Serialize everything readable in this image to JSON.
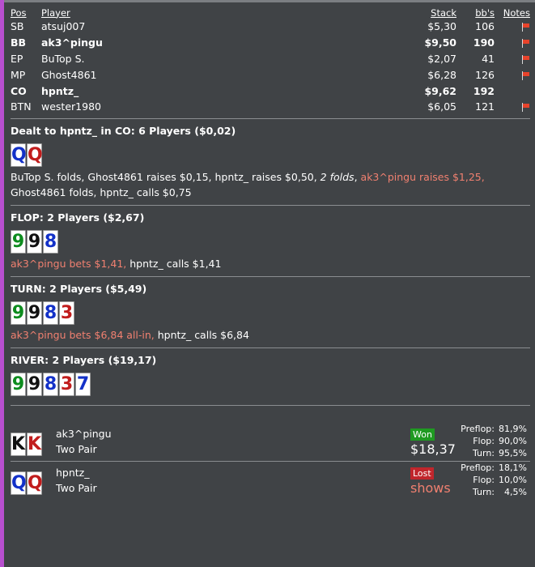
{
  "players_table": {
    "headers": {
      "pos": "Pos",
      "player": "Player",
      "stack": "Stack",
      "bbs": "bb's",
      "notes": "Notes"
    },
    "rows": [
      {
        "pos": "SB",
        "player": "atsuj007",
        "stack": "$5,30",
        "bbs": "106",
        "bold": false,
        "flag": true
      },
      {
        "pos": "BB",
        "player": "ak3^pingu",
        "stack": "$9,50",
        "bbs": "190",
        "bold": true,
        "flag": true
      },
      {
        "pos": "EP",
        "player": "BuTop S.",
        "stack": "$2,07",
        "bbs": "41",
        "bold": false,
        "flag": true
      },
      {
        "pos": "MP",
        "player": "Ghost4861",
        "stack": "$6,28",
        "bbs": "126",
        "bold": false,
        "flag": true
      },
      {
        "pos": "CO",
        "player": "hpntz_",
        "stack": "$9,62",
        "bbs": "192",
        "bold": true,
        "flag": false
      },
      {
        "pos": "BTN",
        "player": "wester1980",
        "stack": "$6,05",
        "bbs": "121",
        "bold": false,
        "flag": true
      }
    ]
  },
  "preflop": {
    "title": "Dealt to hpntz_ in CO: 6 Players ($0,02)",
    "cards": [
      {
        "rank": "Q",
        "suit": "d"
      },
      {
        "rank": "Q",
        "suit": "h"
      }
    ],
    "actions": [
      {
        "text": "BuTop S. folds, Ghost4861 raises $0,15, hpntz_ raises $0,50, ",
        "style": ""
      },
      {
        "text": "2 folds",
        "style": "it"
      },
      {
        "text": ", ",
        "style": ""
      },
      {
        "text": "ak3^pingu raises $1,25,",
        "style": "hl"
      },
      {
        "text": " Ghost4861 folds, hpntz_ calls $0,75",
        "style": ""
      }
    ]
  },
  "flop": {
    "title": "FLOP: 2 Players ($2,67)",
    "cards": [
      {
        "rank": "9",
        "suit": "c"
      },
      {
        "rank": "9",
        "suit": "s"
      },
      {
        "rank": "8",
        "suit": "d"
      }
    ],
    "actions": [
      {
        "text": "ak3^pingu bets $1,41,",
        "style": "hl"
      },
      {
        "text": " hpntz_ calls $1,41",
        "style": ""
      }
    ]
  },
  "turn": {
    "title": "TURN: 2 Players ($5,49)",
    "cards": [
      {
        "rank": "9",
        "suit": "c"
      },
      {
        "rank": "9",
        "suit": "s"
      },
      {
        "rank": "8",
        "suit": "d"
      },
      {
        "rank": "3",
        "suit": "h"
      }
    ],
    "actions": [
      {
        "text": "ak3^pingu bets $6,84 all-in,",
        "style": "hl"
      },
      {
        "text": " hpntz_ calls $6,84",
        "style": ""
      }
    ]
  },
  "river": {
    "title": "RIVER: 2 Players ($19,17)",
    "cards": [
      {
        "rank": "9",
        "suit": "c"
      },
      {
        "rank": "9",
        "suit": "s"
      },
      {
        "rank": "8",
        "suit": "d"
      },
      {
        "rank": "3",
        "suit": "h"
      },
      {
        "rank": "7",
        "suit": "d"
      }
    ]
  },
  "results": [
    {
      "player": "ak3^pingu",
      "hand_desc": "Two Pair",
      "cards": [
        {
          "rank": "K",
          "suit": "s"
        },
        {
          "rank": "K",
          "suit": "h"
        }
      ],
      "badge": "Won",
      "badge_type": "won",
      "amount": "$18,37",
      "equity": [
        {
          "label": "Preflop:",
          "value": "81,9%"
        },
        {
          "label": "Flop:",
          "value": "90,0%"
        },
        {
          "label": "Turn:",
          "value": "95,5%"
        }
      ]
    },
    {
      "player": "hpntz_",
      "hand_desc": "Two Pair",
      "cards": [
        {
          "rank": "Q",
          "suit": "d"
        },
        {
          "rank": "Q",
          "suit": "h"
        }
      ],
      "badge": "Lost",
      "badge_type": "lost",
      "amount": "shows",
      "equity": [
        {
          "label": "Preflop:",
          "value": "18,1%"
        },
        {
          "label": "Flop:",
          "value": "10,0%"
        },
        {
          "label": "Turn:",
          "value": "4,5%"
        }
      ]
    }
  ],
  "colors": {
    "background": "#404346",
    "highlight": "#f08070",
    "won": "#1f9a21",
    "lost": "#c0262c",
    "club": "#0d8c1e",
    "spade": "#111111",
    "diamond": "#1331c8",
    "heart": "#c11d1d"
  },
  "icons": {
    "notes_flag": "note-flag-icon"
  }
}
